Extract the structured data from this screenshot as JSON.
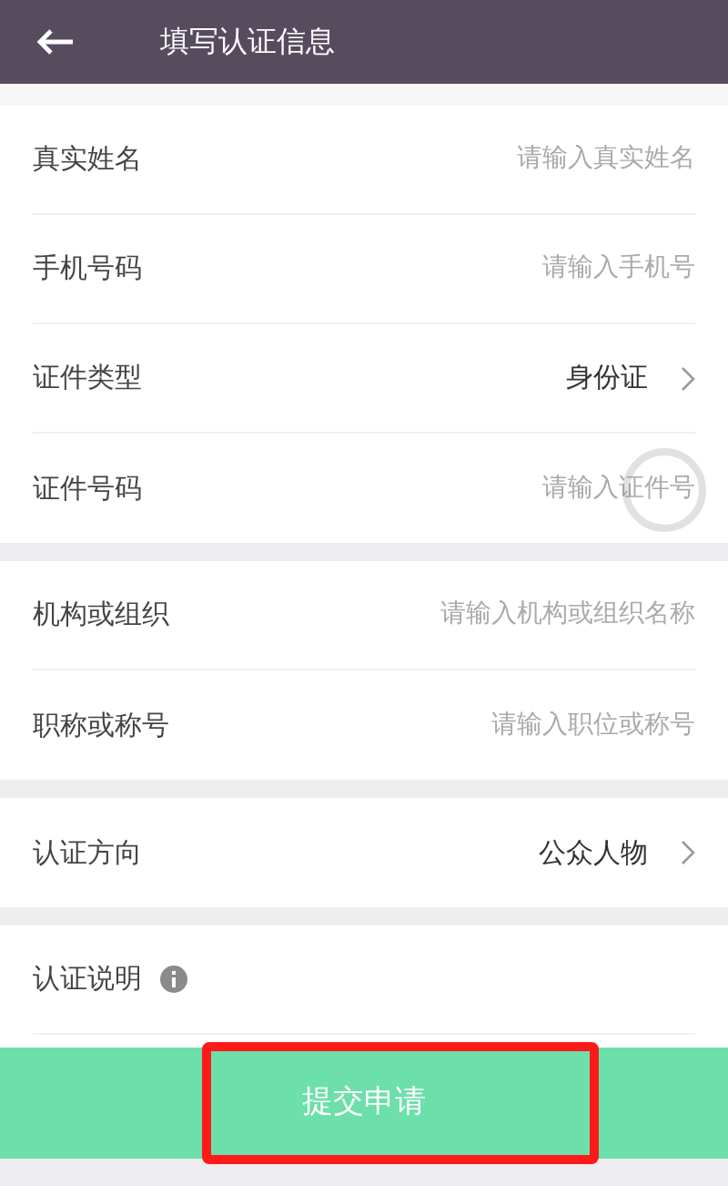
{
  "header": {
    "title": "填写认证信息"
  },
  "sections": [
    {
      "rows": [
        {
          "kind": "input",
          "label": "真实姓名",
          "placeholder": "请输入真实姓名"
        },
        {
          "kind": "input",
          "label": "手机号码",
          "placeholder": "请输入手机号"
        },
        {
          "kind": "select",
          "label": "证件类型",
          "value": "身份证"
        },
        {
          "kind": "input",
          "label": "证件号码",
          "placeholder": "请输入证件号"
        }
      ]
    },
    {
      "rows": [
        {
          "kind": "input",
          "label": "机构或组织",
          "placeholder": "请输入机构或组织名称"
        },
        {
          "kind": "input",
          "label": "职称或称号",
          "placeholder": "请输入职位或称号"
        }
      ]
    },
    {
      "rows": [
        {
          "kind": "select",
          "label": "认证方向",
          "value": "公众人物"
        }
      ]
    },
    {
      "rows": [
        {
          "kind": "info",
          "label": "认证说明"
        }
      ]
    }
  ],
  "submit_button": {
    "label": "提交申请",
    "highlighted": true
  }
}
